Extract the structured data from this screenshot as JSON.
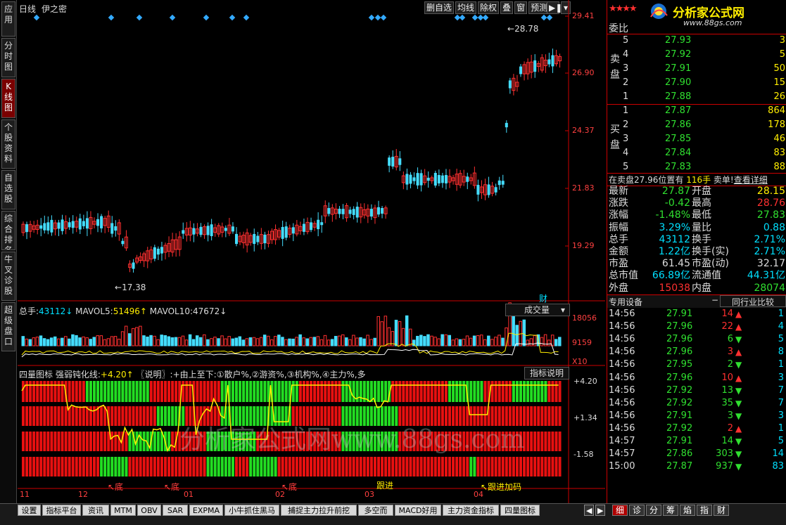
{
  "left_tabs": [
    "应用",
    "分时图",
    "K线图",
    "个股资料",
    "自选股",
    "综合排名",
    "牛叉诊股",
    "超级盘口"
  ],
  "left_active": 2,
  "header": {
    "period": "日线",
    "indicator": "伊之密"
  },
  "toolbar": [
    "删自选",
    "均线",
    "除权",
    "叠",
    "窗",
    "预测"
  ],
  "price_axis": [
    "29.41",
    "26.90",
    "24.37",
    "21.83",
    "19.29"
  ],
  "annotations": {
    "high": "28.78",
    "low": "17.38",
    "cai": "财"
  },
  "volume": {
    "zongshou_label": "总手:",
    "zongshou": "43112↓",
    "mavol5_label": "MAVOL5:",
    "mavol5": "51496↑",
    "mavol10_label": "MAVOL10:",
    "mavol10": "47672↓",
    "selector": "成交量",
    "axis": [
      "18056",
      "9159",
      "X10"
    ]
  },
  "indicator": {
    "title": "四量图标",
    "sub": "强弱钝化线:",
    "value": "+4.20↑",
    "note": "〖说明〗:+由上至下:①散户%,②游资%,③机构%,④主力%,多",
    "explain_btn": "指标说明",
    "axis": [
      "+4.20",
      "+1.34",
      "-1.58"
    ],
    "signals": [
      "↖底",
      "↖底",
      "↖底",
      "跟进",
      "↖跟进加码"
    ]
  },
  "months": [
    "11",
    "12",
    "01",
    "02",
    "03",
    "04"
  ],
  "watermark": "分析家公式网www.88gs.com",
  "brand": {
    "name": "分析家公式网",
    "url": "www.88gs.com"
  },
  "order_book": {
    "weibi_label": "委比",
    "sell_label": "卖盘",
    "buy_label": "买盘",
    "sells": [
      [
        "5",
        "27.93",
        "3"
      ],
      [
        "4",
        "27.92",
        "5"
      ],
      [
        "3",
        "27.91",
        "50"
      ],
      [
        "2",
        "27.90",
        "15"
      ],
      [
        "1",
        "27.88",
        "26"
      ]
    ],
    "buys": [
      [
        "1",
        "27.87",
        "864"
      ],
      [
        "2",
        "27.86",
        "178"
      ],
      [
        "3",
        "27.85",
        "46"
      ],
      [
        "4",
        "27.84",
        "83"
      ],
      [
        "5",
        "27.83",
        "88"
      ]
    ]
  },
  "notice": {
    "text": "在卖盘27.96位置有",
    "qty": "116手",
    "tail": "卖单!",
    "link": "查看详细"
  },
  "stats": [
    [
      "最新",
      "27.87",
      "开盘",
      "28.15"
    ],
    [
      "涨跌",
      "-0.42",
      "最高",
      "28.76"
    ],
    [
      "涨幅",
      "-1.48%",
      "最低",
      "27.83"
    ],
    [
      "振幅",
      "3.29%",
      "量比",
      "0.88"
    ],
    [
      "总手",
      "43112",
      "换手",
      "2.71%"
    ],
    [
      "金额",
      "1.22亿",
      "换手(实)",
      "2.71%"
    ],
    [
      "市盈",
      "61.45",
      "市盈(动)",
      "32.17"
    ],
    [
      "总市值",
      "66.89亿",
      "流通值",
      "44.31亿"
    ],
    [
      "外盘",
      "15038",
      "内盘",
      "28074"
    ]
  ],
  "ticks_header": {
    "left": "专用设备",
    "minus": "−",
    "right": "同行业比较"
  },
  "ticks": [
    [
      "14:56",
      "27.91",
      "14",
      "up",
      "1"
    ],
    [
      "14:56",
      "27.96",
      "22",
      "up",
      "4"
    ],
    [
      "14:56",
      "27.96",
      "6",
      "down",
      "5"
    ],
    [
      "14:56",
      "27.96",
      "3",
      "up",
      "8"
    ],
    [
      "14:56",
      "27.95",
      "2",
      "down",
      "1"
    ],
    [
      "14:56",
      "27.96",
      "10",
      "up",
      "3"
    ],
    [
      "14:56",
      "27.92",
      "13",
      "down",
      "7"
    ],
    [
      "14:56",
      "27.92",
      "35",
      "down",
      "7"
    ],
    [
      "14:56",
      "27.91",
      "3",
      "down",
      "3"
    ],
    [
      "14:56",
      "27.92",
      "2",
      "up",
      "1"
    ],
    [
      "14:57",
      "27.91",
      "14",
      "down",
      "5"
    ],
    [
      "14:57",
      "27.86",
      "303",
      "down",
      "14"
    ],
    [
      "15:00",
      "27.87",
      "937",
      "down",
      "83"
    ]
  ],
  "bottom_tabs": [
    "设置",
    "指标平台",
    "资讯",
    "MTM",
    "OBV",
    "SAR",
    "EXPMA",
    "小牛抓住黑马",
    "捕捉主力拉升前挖",
    "多空而",
    "MACD好用",
    "主力资金指标",
    "四量图标"
  ],
  "detail_tabs": [
    "细",
    "诊",
    "分",
    "筹",
    "焰",
    "指",
    "财"
  ]
}
